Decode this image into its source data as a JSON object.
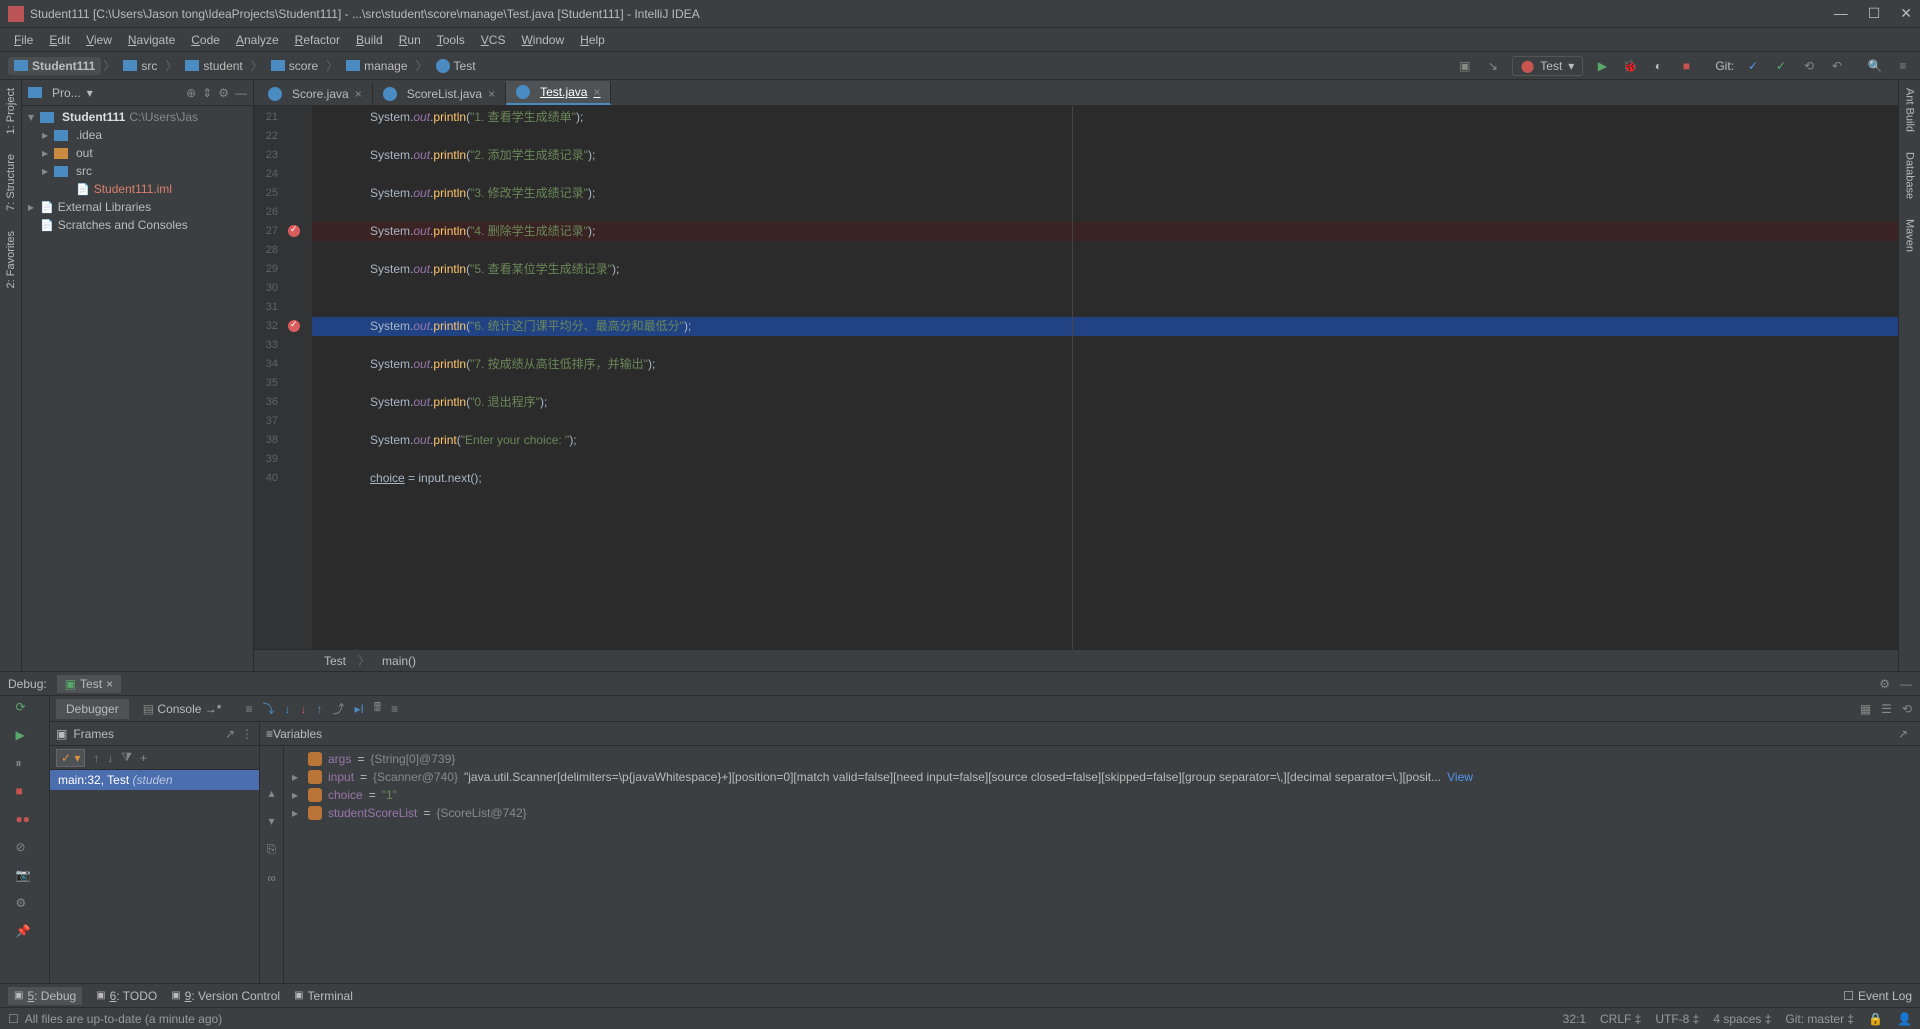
{
  "titlebar": {
    "text": "Student111 [C:\\Users\\Jason tong\\IdeaProjects\\Student111] - ...\\src\\student\\score\\manage\\Test.java [Student111] - IntelliJ IDEA"
  },
  "menubar": [
    "File",
    "Edit",
    "View",
    "Navigate",
    "Code",
    "Analyze",
    "Refactor",
    "Build",
    "Run",
    "Tools",
    "VCS",
    "Window",
    "Help"
  ],
  "breadcrumbs": [
    {
      "label": "Student111",
      "bold": true
    },
    {
      "label": "src"
    },
    {
      "label": "student"
    },
    {
      "label": "score"
    },
    {
      "label": "manage"
    },
    {
      "label": "Test",
      "icon": "class"
    }
  ],
  "runConfig": {
    "name": "Test"
  },
  "navbar_right": {
    "git": "Git:"
  },
  "projectPanel": {
    "header": "Pro...",
    "tree": [
      {
        "level": 0,
        "arrow": "▾",
        "icon": "folder",
        "label": "Student111",
        "suffix": " C:\\Users\\Jas"
      },
      {
        "level": 1,
        "arrow": "▸",
        "icon": "folder",
        "label": ".idea"
      },
      {
        "level": 1,
        "arrow": "▸",
        "icon": "folder-orange",
        "label": "out"
      },
      {
        "level": 1,
        "arrow": "▸",
        "icon": "folder",
        "label": "src"
      },
      {
        "level": 2,
        "arrow": "",
        "icon": "file",
        "label": "Student111.iml",
        "class": "file-iml"
      },
      {
        "level": 0,
        "arrow": "▸",
        "icon": "lib",
        "label": "External Libraries"
      },
      {
        "level": 0,
        "arrow": "",
        "icon": "scratch",
        "label": "Scratches and Consoles"
      }
    ]
  },
  "leftStripe": [
    "1: Project",
    "7: Structure",
    "2: Favorites"
  ],
  "rightStripe": [
    "Ant Build",
    "Database",
    "Maven"
  ],
  "editorTabs": [
    {
      "label": "Score.java",
      "active": false
    },
    {
      "label": "ScoreList.java",
      "active": false
    },
    {
      "label": "Test.java",
      "active": true
    }
  ],
  "editor": {
    "startLine": 21,
    "lines": [
      {
        "n": 21,
        "indent": "            ",
        "code": [
          {
            "t": "System.",
            "c": "kw"
          },
          {
            "t": "out",
            "c": "field"
          },
          {
            "t": ".",
            "c": "kw"
          },
          {
            "t": "println",
            "c": "method"
          },
          {
            "t": "(",
            "c": "kw"
          },
          {
            "t": "\"1. 查看学生成绩单\"",
            "c": "str"
          },
          {
            "t": ");",
            "c": "kw"
          }
        ]
      },
      {
        "n": 22,
        "blank": true
      },
      {
        "n": 23,
        "indent": "            ",
        "code": [
          {
            "t": "System.",
            "c": "kw"
          },
          {
            "t": "out",
            "c": "field"
          },
          {
            "t": ".",
            "c": "kw"
          },
          {
            "t": "println",
            "c": "method"
          },
          {
            "t": "(",
            "c": "kw"
          },
          {
            "t": "\"2. 添加学生成绩记录\"",
            "c": "str"
          },
          {
            "t": ");",
            "c": "kw"
          }
        ]
      },
      {
        "n": 24,
        "blank": true
      },
      {
        "n": 25,
        "indent": "            ",
        "code": [
          {
            "t": "System.",
            "c": "kw"
          },
          {
            "t": "out",
            "c": "field"
          },
          {
            "t": ".",
            "c": "kw"
          },
          {
            "t": "println",
            "c": "method"
          },
          {
            "t": "(",
            "c": "kw"
          },
          {
            "t": "\"3. 修改学生成绩记录\"",
            "c": "str"
          },
          {
            "t": ");",
            "c": "kw"
          }
        ]
      },
      {
        "n": 26,
        "blank": true
      },
      {
        "n": 27,
        "indent": "            ",
        "code": [
          {
            "t": "System.",
            "c": "kw"
          },
          {
            "t": "out",
            "c": "field"
          },
          {
            "t": ".",
            "c": "kw"
          },
          {
            "t": "println",
            "c": "method"
          },
          {
            "t": "(",
            "c": "kw"
          },
          {
            "t": "\"4. 删除学生成绩记录\"",
            "c": "str"
          },
          {
            "t": ");",
            "c": "kw"
          }
        ],
        "bp": true,
        "breakpoint": true
      },
      {
        "n": 28,
        "blank": true
      },
      {
        "n": 29,
        "indent": "            ",
        "code": [
          {
            "t": "System.",
            "c": "kw"
          },
          {
            "t": "out",
            "c": "field"
          },
          {
            "t": ".",
            "c": "kw"
          },
          {
            "t": "println",
            "c": "method"
          },
          {
            "t": "(",
            "c": "kw"
          },
          {
            "t": "\"5. 查看某位学生成绩记录\"",
            "c": "str"
          },
          {
            "t": ");",
            "c": "kw"
          }
        ]
      },
      {
        "n": 30,
        "blank": true
      },
      {
        "n": 31,
        "blank": true
      },
      {
        "n": 32,
        "indent": "            ",
        "code": [
          {
            "t": "System.",
            "c": "kw"
          },
          {
            "t": "out",
            "c": "field"
          },
          {
            "t": ".",
            "c": "kw"
          },
          {
            "t": "println",
            "c": "method"
          },
          {
            "t": "(",
            "c": "kw"
          },
          {
            "t": "\"6. 统计这门课平均分、最高分和最低分\"",
            "c": "str"
          },
          {
            "t": ");",
            "c": "kw"
          }
        ],
        "current": true,
        "breakpoint": true,
        "bulb": true
      },
      {
        "n": 33,
        "blank": true
      },
      {
        "n": 34,
        "indent": "            ",
        "code": [
          {
            "t": "System.",
            "c": "kw"
          },
          {
            "t": "out",
            "c": "field"
          },
          {
            "t": ".",
            "c": "kw"
          },
          {
            "t": "println",
            "c": "method"
          },
          {
            "t": "(",
            "c": "kw"
          },
          {
            "t": "\"7. 按成绩从高往低排序，并输出\"",
            "c": "str"
          },
          {
            "t": ");",
            "c": "kw"
          }
        ]
      },
      {
        "n": 35,
        "blank": true
      },
      {
        "n": 36,
        "indent": "            ",
        "code": [
          {
            "t": "System.",
            "c": "kw"
          },
          {
            "t": "out",
            "c": "field"
          },
          {
            "t": ".",
            "c": "kw"
          },
          {
            "t": "println",
            "c": "method"
          },
          {
            "t": "(",
            "c": "kw"
          },
          {
            "t": "\"0. 退出程序\"",
            "c": "str"
          },
          {
            "t": ");",
            "c": "kw"
          }
        ]
      },
      {
        "n": 37,
        "blank": true
      },
      {
        "n": 38,
        "indent": "            ",
        "code": [
          {
            "t": "System.",
            "c": "kw"
          },
          {
            "t": "out",
            "c": "field"
          },
          {
            "t": ".",
            "c": "kw"
          },
          {
            "t": "print",
            "c": "method"
          },
          {
            "t": "(",
            "c": "kw"
          },
          {
            "t": "\"Enter your choice: \"",
            "c": "str"
          },
          {
            "t": ");",
            "c": "kw"
          }
        ]
      },
      {
        "n": 39,
        "blank": true
      },
      {
        "n": 40,
        "indent": "            ",
        "code": [
          {
            "t": "choice",
            "c": "var"
          },
          {
            "t": " = input.next();",
            "c": "kw"
          }
        ]
      }
    ],
    "breadcrumb": [
      "Test",
      "main()"
    ]
  },
  "debug": {
    "title": "Debug:",
    "tab": "Test",
    "tabs": {
      "debugger": "Debugger",
      "console": "Console"
    },
    "frames": {
      "header": "Frames",
      "item": {
        "main": "main:32, Test ",
        "suffix": "(studen"
      }
    },
    "variables": {
      "header": "Variables",
      "rows": [
        {
          "exp": "",
          "badge": "p",
          "name": "args",
          "eq": " = ",
          "val": "{String[0]@739}"
        },
        {
          "exp": "▸",
          "badge": "f",
          "name": "input",
          "eq": " = ",
          "val": "{Scanner@740} ",
          "extra": "\"java.util.Scanner[delimiters=\\p{javaWhitespace}+][position=0][match valid=false][need input=false][source closed=false][skipped=false][group separator=\\,][decimal separator=\\.][posit...",
          "link": "View"
        },
        {
          "exp": "▸",
          "badge": "f",
          "name": "choice",
          "eq": " = ",
          "str": "\"1\""
        },
        {
          "exp": "▸",
          "badge": "f",
          "name": "studentScoreList",
          "eq": " = ",
          "val": "{ScoreList@742}"
        }
      ]
    }
  },
  "bottomTabs": [
    {
      "label": "5: Debug",
      "active": true,
      "u": "5"
    },
    {
      "label": "6: TODO",
      "u": "6"
    },
    {
      "label": "9: Version Control",
      "u": "9"
    },
    {
      "label": "Terminal"
    }
  ],
  "bottomRight": {
    "eventLog": "Event Log"
  },
  "status": {
    "left": "All files are up-to-date (a minute ago)",
    "right": [
      "32:1",
      "CRLF ‡",
      "UTF-8 ‡",
      "4 spaces ‡",
      "Git: master ‡"
    ]
  }
}
